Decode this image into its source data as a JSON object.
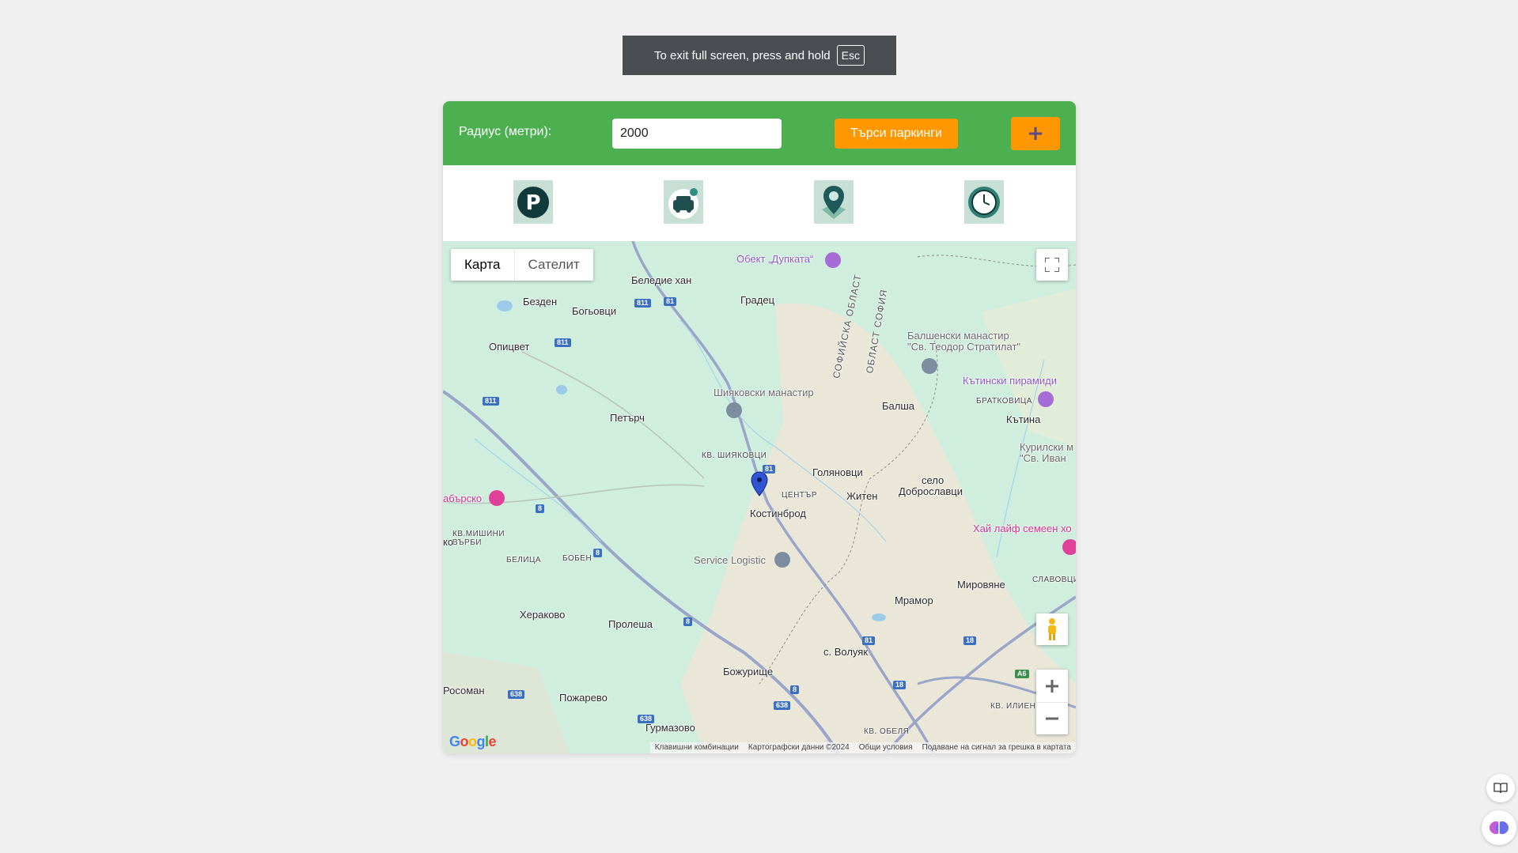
{
  "fullscreen_notice": {
    "text": "To exit full screen, press and hold",
    "key": "Esc"
  },
  "toolbar": {
    "radius_label": "Радиус (метри):",
    "radius_value": "2000",
    "search_label": "Търси паркинги",
    "add_label": "+"
  },
  "feature_icons": [
    "parking-icon",
    "car-location-icon",
    "map-pin-icon",
    "clock-icon"
  ],
  "map": {
    "type_tabs": [
      "Карта",
      "Сателит"
    ],
    "active_tab": "Карта",
    "labels": {
      "dupkata": "Обект „Дупката“",
      "beledie_han": "Беледие хан",
      "bezden": "Безден",
      "bogyovtsi": "Богьовци",
      "gradets": "Градец",
      "opitsvet": "Опицвет",
      "sofiyska_oblast": "СОФИЙСКА ОБЛАСТ",
      "oblast_sofia": "ОБЛАСТ СОФИЯ",
      "monastery_balsha": "Балшенски манастир\n\"Св. Теодор Стратилат\"",
      "shiyakovski": "Шияковски манастир",
      "kutinski": "Кътински пирамиди",
      "bratkovitsa": "БРАТКОВИЦА",
      "petarch": "Петърч",
      "balsha": "Балша",
      "kutina": "Кътина",
      "kurilski": "Курилски м\n\"Св. Иван",
      "kv_shiyakovtsi": "КВ. ШИЯКОВЦИ",
      "golyanovtsi": "Голяновци",
      "selo": "село",
      "dobroslavtsi": "Доброславци",
      "tsentar": "ЦЕНТЪР",
      "zhiten": "Житен",
      "kostinbrod": "Костинброд",
      "dragovo": "абърско",
      "kv_mishini": "КВ.МИШИНИ\nВЪРБИ",
      "ko": "ко",
      "hai_laif": "Хай лайф семеен хо",
      "belitsa": "БЕЛИЦА",
      "boben": "БОБЕН",
      "service_logistic": "Service Logistic",
      "mirovyane": "Мировяне",
      "slavovtsi": "СЛАВОВЦИ",
      "herakovo": "Хераково",
      "prolesha": "Пролеша",
      "mramor": "Мрамор",
      "volyak": "с. Волуяк",
      "bozhurishte": "Божурище",
      "rosoman": "Росоман",
      "pozharevo": "Пожарево",
      "gurmazovo": "Гурмазово",
      "kv_ilientsi": "КВ. ИЛИЕН",
      "kv_obelya": "КВ. ОБЕЛЯ"
    },
    "shields": [
      "811",
      "81",
      "811",
      "811",
      "81",
      "8",
      "8",
      "8",
      "81",
      "18",
      "18",
      "638",
      "638",
      "638",
      "8",
      "A6"
    ],
    "attribution": [
      "Клавишни комбинации",
      "Картографски данни ©2024",
      "Общи условия",
      "Подаване на сигнал за грешка в картата"
    ],
    "logo": "Google"
  },
  "colors": {
    "green": "#4caf50",
    "orange": "#ff9800",
    "map_green": "#cfeedd"
  }
}
